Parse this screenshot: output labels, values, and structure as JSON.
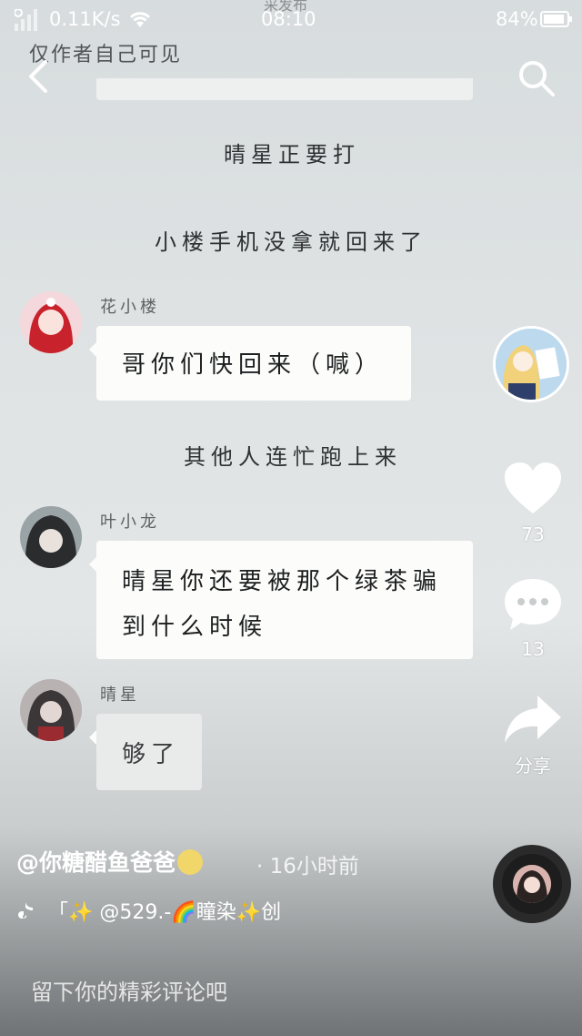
{
  "status_bar": {
    "network_speed": "0.11K/s",
    "time": "08:10",
    "battery": "84%"
  },
  "faded_header_text": "采发布",
  "privacy_notice": "仅作者自己可见",
  "story": {
    "narration_1": "晴星正要打",
    "narration_2": "小楼手机没拿就回来了",
    "msg1": {
      "name": "花小楼",
      "text": "哥你们快回来（喊）"
    },
    "narration_3": "其他人连忙跑上来",
    "msg2": {
      "name": "叶小龙",
      "line1": "晴星你还要被那个绿茶骗",
      "line2": "到什么时候"
    },
    "msg3": {
      "name": "晴星",
      "text": "够了"
    }
  },
  "actions": {
    "like_count": "73",
    "comment_count": "13",
    "share_label": "分享"
  },
  "author": {
    "handle": "@你糖醋鱼爸爸",
    "time_ago": "16小时前"
  },
  "music": {
    "text": "「✨ @529.-🌈瞳染✨创"
  },
  "comment_placeholder": "留下你的精彩评论吧",
  "colors": {
    "accent_white": "#ffffff",
    "moon": "#f1d66a"
  }
}
